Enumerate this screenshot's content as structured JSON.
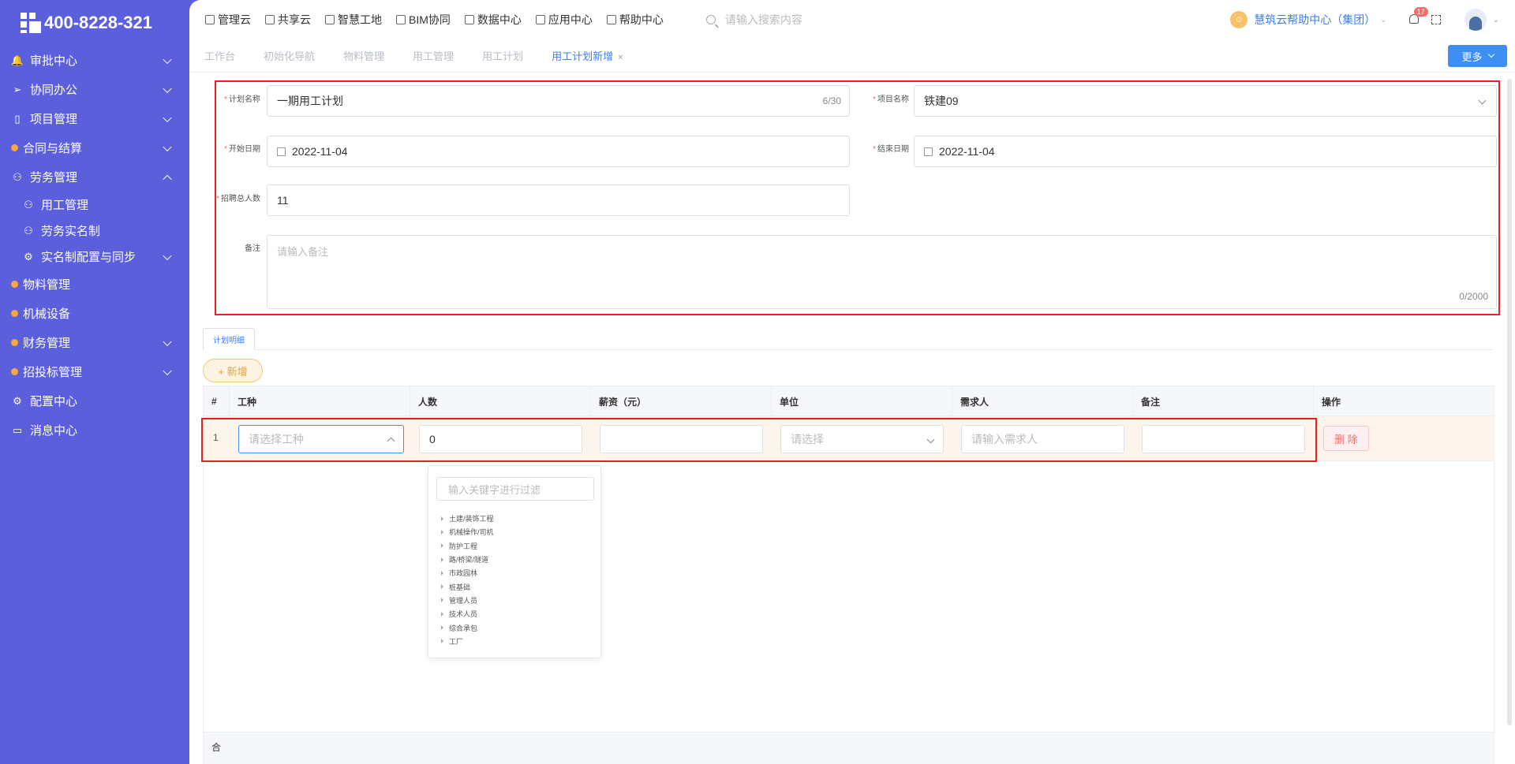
{
  "brand": {
    "phone": "400-8228-321"
  },
  "sidebar": {
    "items": [
      {
        "label": "审批中心",
        "icon": "bell-icon",
        "chevron": "down"
      },
      {
        "label": "协同办公",
        "icon": "send-icon",
        "chevron": "down"
      },
      {
        "label": "项目管理",
        "icon": "book-icon",
        "chevron": "down"
      },
      {
        "label": "合同与结算",
        "icon": "dot-icon",
        "chevron": "down"
      },
      {
        "label": "劳务管理",
        "icon": "user-icon",
        "chevron": "up"
      },
      {
        "label": "用工管理",
        "icon": "user-icon",
        "sub": true
      },
      {
        "label": "劳务实名制",
        "icon": "user-icon",
        "sub": true
      },
      {
        "label": "实名制配置与同步",
        "icon": "gear-icon",
        "sub": true,
        "chevron": "down"
      },
      {
        "label": "物料管理",
        "icon": "dot-icon"
      },
      {
        "label": "机械设备",
        "icon": "dot-icon"
      },
      {
        "label": "财务管理",
        "icon": "dot-icon",
        "chevron": "down"
      },
      {
        "label": "招投标管理",
        "icon": "dot-icon",
        "chevron": "down"
      },
      {
        "label": "配置中心",
        "icon": "gear-icon"
      },
      {
        "label": "消息中心",
        "icon": "message-icon"
      }
    ]
  },
  "topnav": {
    "links": [
      "管理云",
      "共享云",
      "智慧工地",
      "BIM协同",
      "数据中心",
      "应用中心",
      "帮助中心"
    ],
    "search_placeholder": "请输入搜索内容",
    "help_center": "慧筑云帮助中心（集团）",
    "notification_count": "17"
  },
  "tabs": {
    "items": [
      "工作台",
      "初始化导航",
      "物料管理",
      "用工管理",
      "用工计划",
      "用工计划新增"
    ],
    "close": "×",
    "more_label": "更多"
  },
  "form": {
    "plan_name_label": "计划名称",
    "plan_name_value": "一期用工计划",
    "plan_name_count": "6/30",
    "project_label": "项目名称",
    "project_value": "铁建09",
    "start_label": "开始日期",
    "start_value": "2022-11-04",
    "end_label": "结束日期",
    "end_value": "2022-11-04",
    "total_label": "招聘总人数",
    "total_value": "11",
    "remark_label": "备注",
    "remark_placeholder": "请输入备注",
    "remark_count": "0/2000",
    "required_mark": "*"
  },
  "detail": {
    "tab_label": "计划明细",
    "add_label": "+ 新增",
    "columns": [
      "#",
      "工种",
      "人数",
      "薪资（元）",
      "单位",
      "需求人",
      "备注",
      "操作"
    ],
    "row": {
      "index": "1",
      "job_placeholder": "请选择工种",
      "count_value": "0",
      "unit_placeholder": "请选择",
      "requester_placeholder": "请输入需求人",
      "delete_label": "删 除"
    },
    "footer_label": "合"
  },
  "dropdown": {
    "filter_placeholder": "输入关键字进行过滤",
    "items": [
      "土建/装饰工程",
      "机械操作/司机",
      "防护工程",
      "路/桥梁/隧道",
      "市政园林",
      "桩基础",
      "管理人员",
      "技术人员",
      "综合承包",
      "工厂"
    ]
  }
}
